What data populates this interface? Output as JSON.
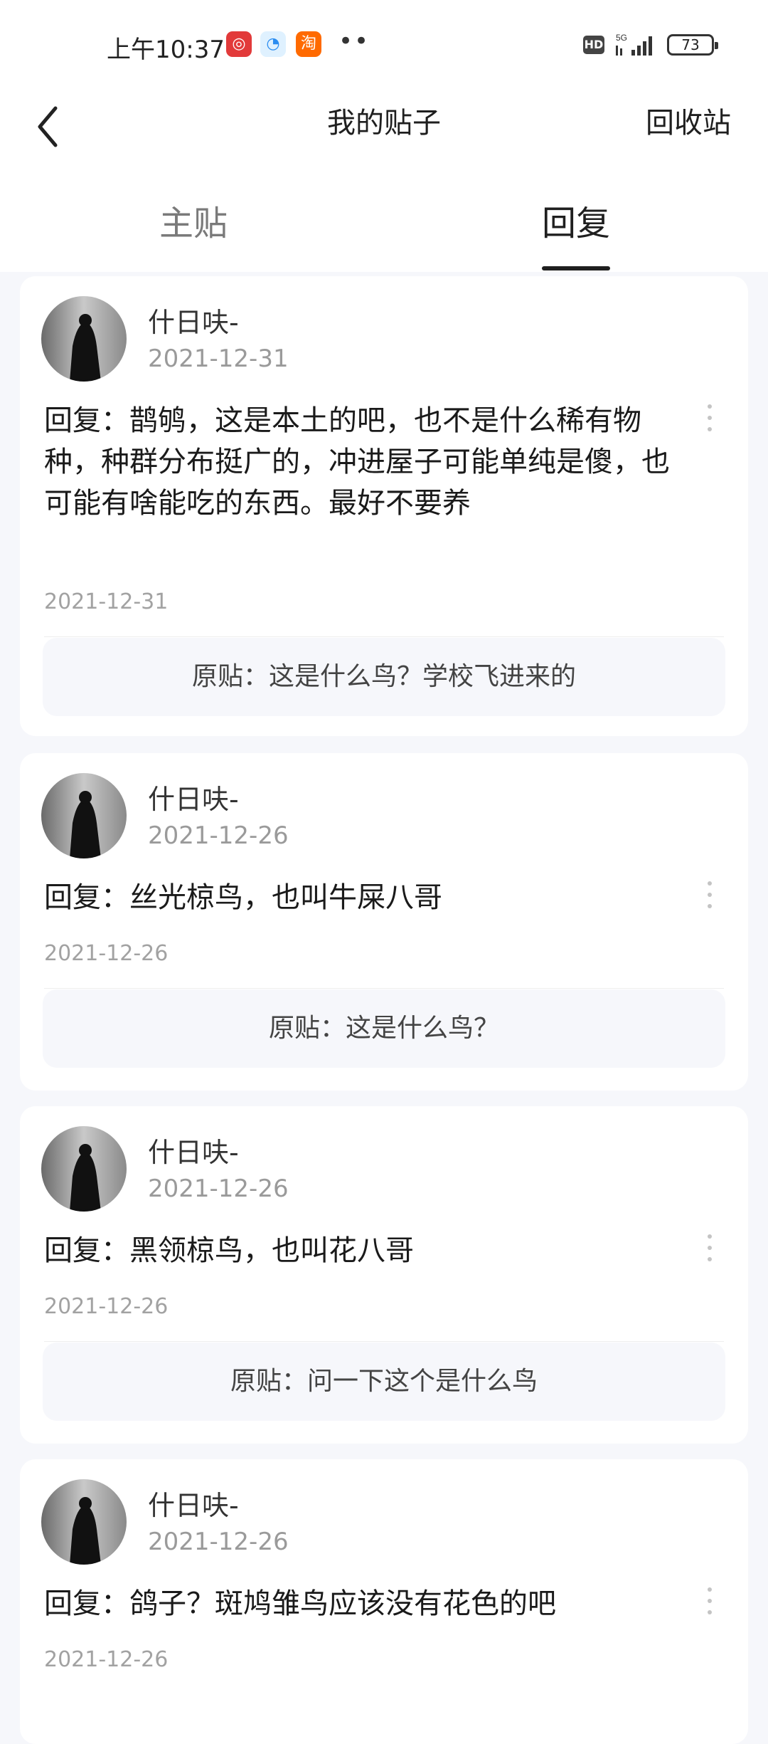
{
  "status_bar": {
    "time": "上午10:37",
    "app_icons": [
      "netease-music-icon",
      "qq-browser-icon",
      "taobao-icon"
    ],
    "taobao_label": "淘",
    "hd_label": "HD",
    "network_label": "5G",
    "battery": "73"
  },
  "nav": {
    "title": "我的贴子",
    "right_action": "回收站"
  },
  "tabs": [
    {
      "label": "主贴",
      "active": false
    },
    {
      "label": "回复",
      "active": true
    }
  ],
  "replies": [
    {
      "username": "什日呋-",
      "user_date": "2021-12-31",
      "text": "回复：鹊鸲，这是本土的吧，也不是什么稀有物种，种群分布挺广的，冲进屋子可能单纯是傻，也可能有啥能吃的东西。最好不要养",
      "date": "2021-12-31",
      "original": "原贴：这是什么鸟？学校飞进来的"
    },
    {
      "username": "什日呋-",
      "user_date": "2021-12-26",
      "text": "回复：丝光椋鸟，也叫牛屎八哥",
      "date": "2021-12-26",
      "original": "原贴：这是什么鸟？"
    },
    {
      "username": "什日呋-",
      "user_date": "2021-12-26",
      "text": "回复：黑领椋鸟，也叫花八哥",
      "date": "2021-12-26",
      "original": "原贴：问一下这个是什么鸟"
    },
    {
      "username": "什日呋-",
      "user_date": "2021-12-26",
      "text": "回复：鸽子？斑鸠雏鸟应该没有花色的吧",
      "date": "2021-12-26",
      "original": ""
    }
  ]
}
